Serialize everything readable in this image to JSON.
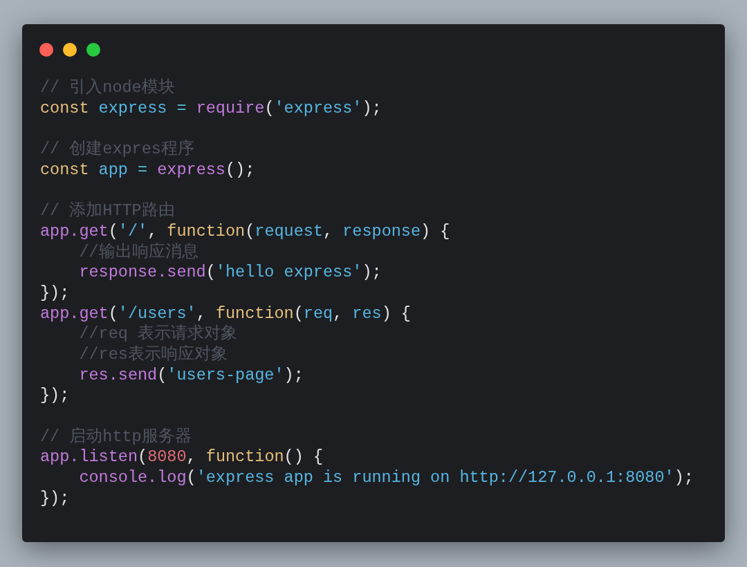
{
  "window": {
    "controls": [
      {
        "color": "#ff5f56"
      },
      {
        "color": "#ffbd2e"
      },
      {
        "color": "#27c93f"
      }
    ]
  },
  "code": {
    "blocks": [
      {
        "lines": [
          {
            "indented": false,
            "tokens": [
              {
                "kind": "comment",
                "text": "// 引入node模块"
              }
            ]
          },
          {
            "indented": false,
            "tokens": [
              {
                "kind": "keyword",
                "text": "const"
              },
              {
                "kind": "variable",
                "text": " express"
              },
              {
                "kind": "operator",
                "text": " = "
              },
              {
                "kind": "call",
                "text": "require"
              },
              {
                "kind": "punct",
                "text": "("
              },
              {
                "kind": "string",
                "text": "'express'"
              },
              {
                "kind": "punct",
                "text": ");"
              }
            ]
          }
        ]
      },
      {
        "lines": [
          {
            "indented": false,
            "tokens": [
              {
                "kind": "comment",
                "text": "// 创建expres程序"
              }
            ]
          },
          {
            "indented": false,
            "tokens": [
              {
                "kind": "keyword",
                "text": "const"
              },
              {
                "kind": "variable",
                "text": " app"
              },
              {
                "kind": "operator",
                "text": " = "
              },
              {
                "kind": "call",
                "text": "express"
              },
              {
                "kind": "punct",
                "text": "();"
              }
            ]
          }
        ]
      },
      {
        "lines": [
          {
            "indented": false,
            "tokens": [
              {
                "kind": "comment",
                "text": "// 添加HTTP路由"
              }
            ]
          },
          {
            "indented": false,
            "tokens": [
              {
                "kind": "call",
                "text": "app.get"
              },
              {
                "kind": "punct",
                "text": "("
              },
              {
                "kind": "string",
                "text": "'/'"
              },
              {
                "kind": "punct",
                "text": ", "
              },
              {
                "kind": "keyword",
                "text": "function"
              },
              {
                "kind": "punct",
                "text": "("
              },
              {
                "kind": "variable",
                "text": "request"
              },
              {
                "kind": "punct",
                "text": ", "
              },
              {
                "kind": "variable",
                "text": "response"
              },
              {
                "kind": "punct",
                "text": ") {"
              }
            ]
          },
          {
            "indented": true,
            "tokens": [
              {
                "kind": "comment",
                "text": "//输出响应消息"
              }
            ]
          },
          {
            "indented": true,
            "tokens": [
              {
                "kind": "call",
                "text": "response.send"
              },
              {
                "kind": "punct",
                "text": "("
              },
              {
                "kind": "string",
                "text": "'hello express'"
              },
              {
                "kind": "punct",
                "text": ");"
              }
            ]
          },
          {
            "indented": false,
            "tokens": [
              {
                "kind": "punct",
                "text": "});"
              }
            ]
          },
          {
            "indented": false,
            "tokens": [
              {
                "kind": "call",
                "text": "app.get"
              },
              {
                "kind": "punct",
                "text": "("
              },
              {
                "kind": "string",
                "text": "'/users'"
              },
              {
                "kind": "punct",
                "text": ", "
              },
              {
                "kind": "keyword",
                "text": "function"
              },
              {
                "kind": "punct",
                "text": "("
              },
              {
                "kind": "variable",
                "text": "req"
              },
              {
                "kind": "punct",
                "text": ", "
              },
              {
                "kind": "variable",
                "text": "res"
              },
              {
                "kind": "punct",
                "text": ") {"
              }
            ]
          },
          {
            "indented": true,
            "tokens": [
              {
                "kind": "comment",
                "text": "//req 表示请求对象"
              }
            ]
          },
          {
            "indented": true,
            "tokens": [
              {
                "kind": "comment",
                "text": "//res表示响应对象"
              }
            ]
          },
          {
            "indented": true,
            "tokens": [
              {
                "kind": "call",
                "text": "res.send"
              },
              {
                "kind": "punct",
                "text": "("
              },
              {
                "kind": "string",
                "text": "'users-page'"
              },
              {
                "kind": "punct",
                "text": ");"
              }
            ]
          },
          {
            "indented": false,
            "tokens": [
              {
                "kind": "punct",
                "text": "});"
              }
            ]
          }
        ]
      },
      {
        "lines": [
          {
            "indented": false,
            "tokens": [
              {
                "kind": "comment",
                "text": "// 启动http服务器"
              }
            ]
          },
          {
            "indented": false,
            "tokens": [
              {
                "kind": "call",
                "text": "app.listen"
              },
              {
                "kind": "punct",
                "text": "("
              },
              {
                "kind": "number",
                "text": "8080"
              },
              {
                "kind": "punct",
                "text": ", "
              },
              {
                "kind": "keyword",
                "text": "function"
              },
              {
                "kind": "punct",
                "text": "() {"
              }
            ]
          },
          {
            "indented": true,
            "tokens": [
              {
                "kind": "call",
                "text": "console.log"
              },
              {
                "kind": "punct",
                "text": "("
              },
              {
                "kind": "string",
                "text": "'express app is running on http://127.0.0.1:8080'"
              },
              {
                "kind": "punct",
                "text": ");"
              }
            ]
          },
          {
            "indented": false,
            "tokens": [
              {
                "kind": "punct",
                "text": "});"
              }
            ]
          }
        ]
      }
    ]
  }
}
